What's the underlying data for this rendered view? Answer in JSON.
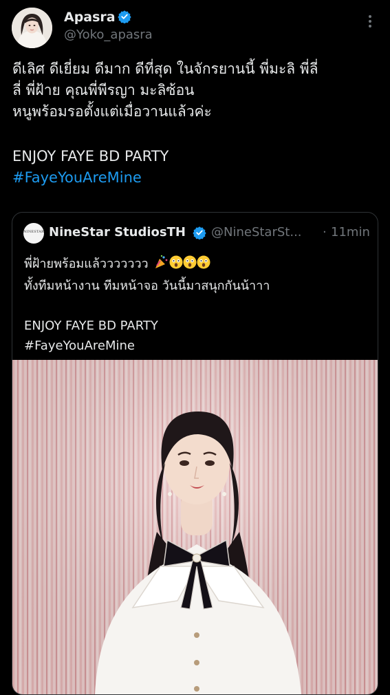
{
  "tweet": {
    "author": {
      "display_name": "Apasra",
      "handle": "@Yoko_apasra",
      "verified": true
    },
    "text_lines": [
      "ดีเลิศ ดีเยี่ยม ดีมาก ดีที่สุด ในจักรยานนี้ พี่มะลิ พี่ลี่",
      "ลี่ พี่ฝ้าย คุณพี่พีรญา มะลิซ้อน",
      "หนูพร้อมรอตั้งแต่เมื่อวานแล้วค่ะ",
      "ENJOY FAYE BD PARTY"
    ],
    "hashtag": "#FayeYouAreMine"
  },
  "quoted": {
    "author": {
      "display_name": "NineStar StudiosTH",
      "handle": "@NineStarSt...",
      "avatar_text": "NINESTAR",
      "verified": true
    },
    "separator": "·",
    "time": "11min",
    "text_lines": [
      "พี่ฝ้ายพร้อมแล้ววววววว",
      "ทั้งทีมหน้างาน ทีมหน้าจอ วันนี้มาสนุกกันน้าาา",
      "ENJOY FAYE BD PARTY",
      "#FayeYouAreMine"
    ],
    "emojis": [
      "party-popper-emoji",
      "astonished-face-emoji",
      "astonished-face-emoji",
      "astonished-face-emoji"
    ]
  },
  "colors": {
    "background": "#000000",
    "text": "#e7e9ea",
    "muted": "#71767b",
    "accent": "#1d9bf0",
    "border": "#2f3336"
  }
}
